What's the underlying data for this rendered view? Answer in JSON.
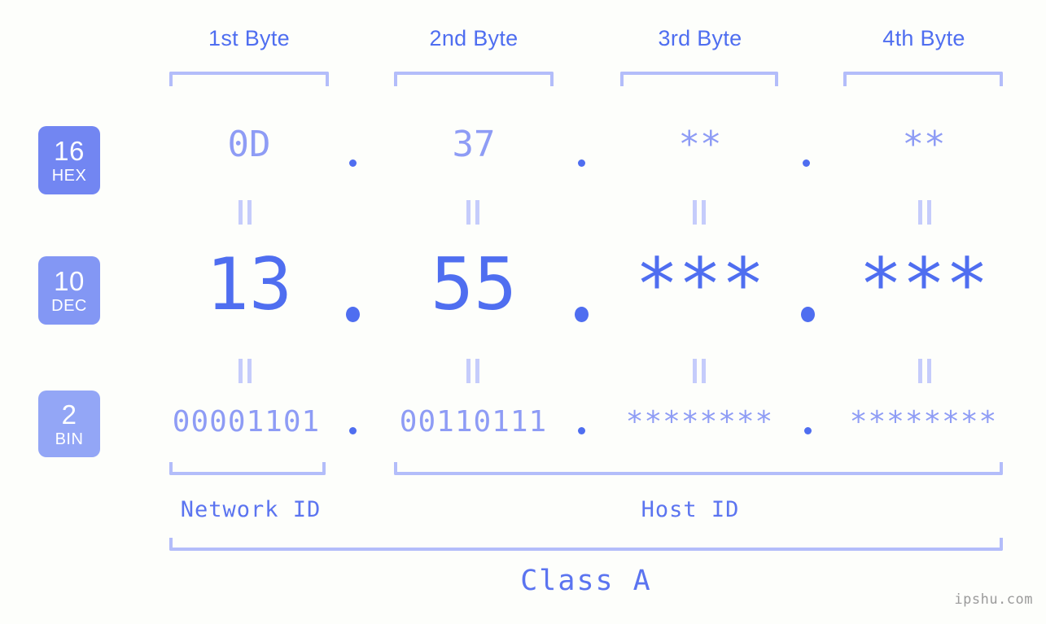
{
  "headers": [
    {
      "label": "1st Byte"
    },
    {
      "label": "2nd Byte"
    },
    {
      "label": "3rd Byte"
    },
    {
      "label": "4th Byte"
    }
  ],
  "bases": [
    {
      "num": "16",
      "abbr": "HEX",
      "color": "#7286f2"
    },
    {
      "num": "10",
      "abbr": "DEC",
      "color": "#8397f4"
    },
    {
      "num": "2",
      "abbr": "BIN",
      "color": "#93a6f6"
    }
  ],
  "rows": {
    "hex": {
      "values": [
        "0D",
        "37",
        "**",
        "**"
      ]
    },
    "dec": {
      "values": [
        "13",
        "55",
        "***",
        "***"
      ]
    },
    "bin": {
      "values": [
        "00001101",
        "00110111",
        "********",
        "********"
      ]
    }
  },
  "separator": ".",
  "equals": "=",
  "spans": {
    "network_id": "Network ID",
    "host_id": "Host ID",
    "class": "Class A"
  },
  "watermark": "ipshu.com",
  "colors": {
    "background": "#fdfefb",
    "accent": "#4f6ef0",
    "muted": "#8e9cf5",
    "bracket": "#b3bdfa"
  }
}
